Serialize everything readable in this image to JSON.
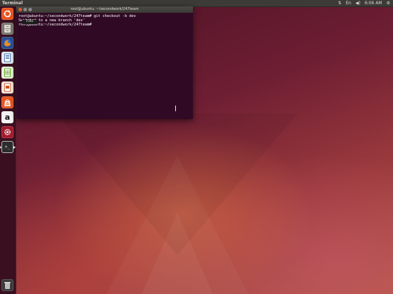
{
  "top_panel": {
    "app_title": "Terminal",
    "indicators": {
      "network_icon": "network-icon",
      "keyboard_icon": "keyboard-icon",
      "volume_icon": "volume-icon",
      "time": "6:06 AM",
      "settings_icon": "gear-icon"
    }
  },
  "launcher": {
    "items": [
      {
        "name": "dash-home",
        "icon": "ubuntu-logo-icon",
        "color": "#e95420"
      },
      {
        "name": "files",
        "icon": "file-cabinet-icon",
        "color": "#6b6863"
      },
      {
        "name": "firefox",
        "icon": "firefox-icon",
        "color": "#e66000"
      },
      {
        "name": "libreoffice-writer",
        "icon": "writer-icon",
        "color": "#3465a4"
      },
      {
        "name": "libreoffice-calc",
        "icon": "calc-icon",
        "color": "#4e9a06"
      },
      {
        "name": "libreoffice-impress",
        "icon": "impress-icon",
        "color": "#c4541c"
      },
      {
        "name": "ubuntu-software",
        "icon": "shopping-bag-icon",
        "color": "#e95420"
      },
      {
        "name": "amazon",
        "icon": "amazon-icon",
        "color": "#ffffff"
      },
      {
        "name": "system-settings",
        "icon": "settings-icon",
        "color": "#c1272d"
      },
      {
        "name": "terminal",
        "icon": "terminal-icon",
        "color": "#2c2c2c"
      },
      {
        "name": "trash",
        "icon": "trash-icon",
        "color": "#4a4a4a"
      }
    ],
    "amazon_glyph": "a",
    "terminal_glyph": ">_"
  },
  "terminal": {
    "title": "root@ubuntu: ~/secondwork/247team",
    "lines": [
      "root@ubuntu:~/secondwork/247team# git checkout -b dev",
      "Switched to a new branch 'dev'",
      "root@ubuntu:~/secondwork/247team#"
    ],
    "tooltip": "Files"
  }
}
